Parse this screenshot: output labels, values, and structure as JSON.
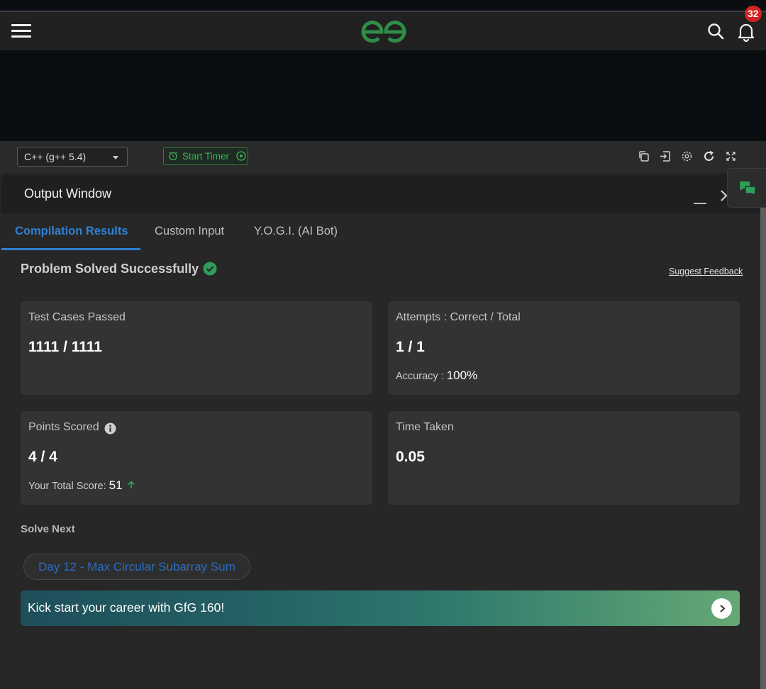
{
  "header": {
    "logo": "GfG",
    "notification_count": "32"
  },
  "toolbar": {
    "language": "C++ (g++ 5.4)",
    "timer_label": "Start Timer"
  },
  "output_window": {
    "title": "Output Window",
    "tabs": [
      {
        "label": "Compilation Results",
        "active": true
      },
      {
        "label": "Custom Input",
        "active": false
      },
      {
        "label": "Y.O.G.I. (AI Bot)",
        "active": false
      }
    ],
    "status": "Problem Solved Successfully",
    "feedback_link": "Suggest Feedback",
    "cards": {
      "test_cases": {
        "label": "Test Cases Passed",
        "value": "1111 / 1111"
      },
      "attempts": {
        "label": "Attempts : Correct / Total",
        "value": "1 / 1",
        "sub_label": "Accuracy :",
        "sub_value": "100%"
      },
      "points": {
        "label": "Points Scored",
        "value": "4 / 4",
        "sub_label": "Your Total Score:",
        "sub_value": "51"
      },
      "time": {
        "label": "Time Taken",
        "value": "0.05"
      }
    },
    "solve_next_heading": "Solve Next",
    "next_problem": "Day 12 - Max Circular Subarray Sum",
    "banner_text": "Kick start your career with GfG 160!"
  },
  "colors": {
    "brand_green": "#2f8d46",
    "active_tab_blue": "#2f80d4",
    "success_green": "#2f9e57",
    "badge_red": "#d32222"
  },
  "icons": [
    "menu-icon",
    "gfg-logo",
    "search-icon",
    "bell-icon",
    "alarm-icon",
    "play-icon",
    "copy-icon",
    "submit-icon",
    "settings-icon",
    "reset-icon",
    "fullscreen-icon",
    "chat-icon",
    "minimize-icon",
    "close-icon",
    "check-circle-icon",
    "info-icon",
    "arrow-up-icon",
    "chevron-right-icon"
  ]
}
